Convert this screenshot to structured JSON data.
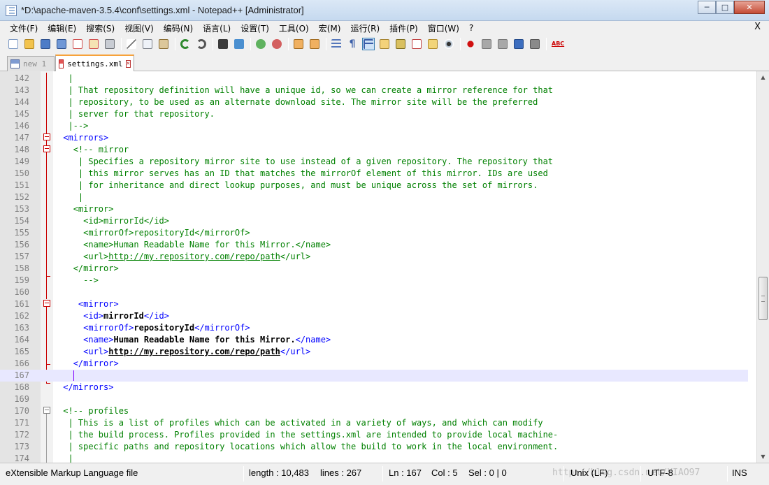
{
  "window": {
    "title": "*D:\\apache-maven-3.5.4\\conf\\settings.xml - Notepad++ [Administrator]",
    "minimize": "─",
    "maximize": "□",
    "close": "✕"
  },
  "menu": {
    "items": [
      "文件(F)",
      "编辑(E)",
      "搜索(S)",
      "视图(V)",
      "编码(N)",
      "语言(L)",
      "设置(T)",
      "工具(O)",
      "宏(M)",
      "运行(R)",
      "插件(P)",
      "窗口(W)",
      "?"
    ],
    "close_label": "X"
  },
  "toolbar": {
    "buttons": [
      "new-file-icon",
      "open-file-icon",
      "save-icon",
      "save-all-icon",
      "close-icon",
      "close-all-icon",
      "print-icon",
      "cut-icon",
      "copy-icon",
      "paste-icon",
      "undo-icon",
      "redo-icon",
      "find-icon",
      "replace-icon",
      "zoom-in-icon",
      "zoom-out-icon",
      "sync-vertical-icon",
      "sync-horizontal-icon",
      "word-wrap-icon",
      "show-all-chars-icon",
      "indent-guide-icon",
      "lang-icon",
      "doc-map-icon",
      "function-list-icon",
      "folder-workspace-icon",
      "monitor-icon",
      "record-macro-icon",
      "stop-record-icon",
      "play-macro-icon",
      "play-multiple-icon",
      "save-macro-icon",
      "spellcheck-icon"
    ]
  },
  "tabs": [
    {
      "label": "new 1",
      "close": "✕"
    },
    {
      "label": "settings.xml",
      "close": "✕"
    }
  ],
  "editor": {
    "lines": [
      {
        "n": "142",
        "code": "  |"
      },
      {
        "n": "143",
        "code": "  | That repository definition will have a unique id, so we can create a mirror reference for that"
      },
      {
        "n": "144",
        "code": "  | repository, to be used as an alternate download site. The mirror site will be the preferred"
      },
      {
        "n": "145",
        "code": "  | server for that repository."
      },
      {
        "n": "146",
        "code": "  |-->"
      },
      {
        "n": "147",
        "code": ""
      },
      {
        "n": "148",
        "code": ""
      },
      {
        "n": "149",
        "code": "    | Specifies a repository mirror site to use instead of a given repository. The repository that"
      },
      {
        "n": "150",
        "code": "    | this mirror serves has an ID that matches the mirrorOf element of this mirror. IDs are used"
      },
      {
        "n": "151",
        "code": "    | for inheritance and direct lookup purposes, and must be unique across the set of mirrors."
      },
      {
        "n": "152",
        "code": "    |"
      },
      {
        "n": "153",
        "code": ""
      },
      {
        "n": "154",
        "code": ""
      },
      {
        "n": "155",
        "code": ""
      },
      {
        "n": "156",
        "code": ""
      },
      {
        "n": "157",
        "code": ""
      },
      {
        "n": "158",
        "code": ""
      },
      {
        "n": "159",
        "code": "     -->"
      },
      {
        "n": "160",
        "code": ""
      },
      {
        "n": "161",
        "code": ""
      },
      {
        "n": "162",
        "code": ""
      },
      {
        "n": "163",
        "code": ""
      },
      {
        "n": "164",
        "code": ""
      },
      {
        "n": "165",
        "code": ""
      },
      {
        "n": "166",
        "code": ""
      },
      {
        "n": "167",
        "code": ""
      },
      {
        "n": "168",
        "code": ""
      },
      {
        "n": "169",
        "code": ""
      },
      {
        "n": "170",
        "code": " <!-- profiles"
      },
      {
        "n": "171",
        "code": "  | This is a list of profiles which can be activated in a variety of ways, and which can modify"
      },
      {
        "n": "172",
        "code": "  | the build process. Profiles provided in the settings.xml are intended to provide local machine-"
      },
      {
        "n": "173",
        "code": "  | specific paths and repository locations which allow the build to work in the local environment."
      },
      {
        "n": "174",
        "code": "  |"
      }
    ],
    "tags": {
      "mirrors_open": "<mirrors>",
      "mirror_comment": "<!-- mirror",
      "mirror_open": "<mirror>",
      "id_open": "<id>",
      "id_close": "</id>",
      "mirrorof_open": "<mirrorOf>",
      "mirrorof_close": "</mirrorOf>",
      "name_open": "<name>",
      "name_close": "</name>",
      "url_open": "<url>",
      "url_close": "</url>",
      "mirror_close": "</mirror>",
      "mirrors_close": "</mirrors>"
    },
    "values": {
      "mirror_id": "mirrorId",
      "repository_id": "repositoryId",
      "mirror_name": "Human Readable Name for this Mirror.",
      "mirror_url": "http://my.repository.com/repo/path"
    },
    "current_line": "167"
  },
  "status": {
    "file_type": "eXtensible Markup Language file",
    "length": "length : 10,483",
    "lines": "lines : 267",
    "ln": "Ln : 167",
    "col": "Col : 5",
    "sel": "Sel : 0 | 0",
    "eol": "Unix (LF)",
    "encoding": "UTF-8",
    "mode": "INS",
    "watermark": "http://blog.csdn.net/XIAO97"
  }
}
